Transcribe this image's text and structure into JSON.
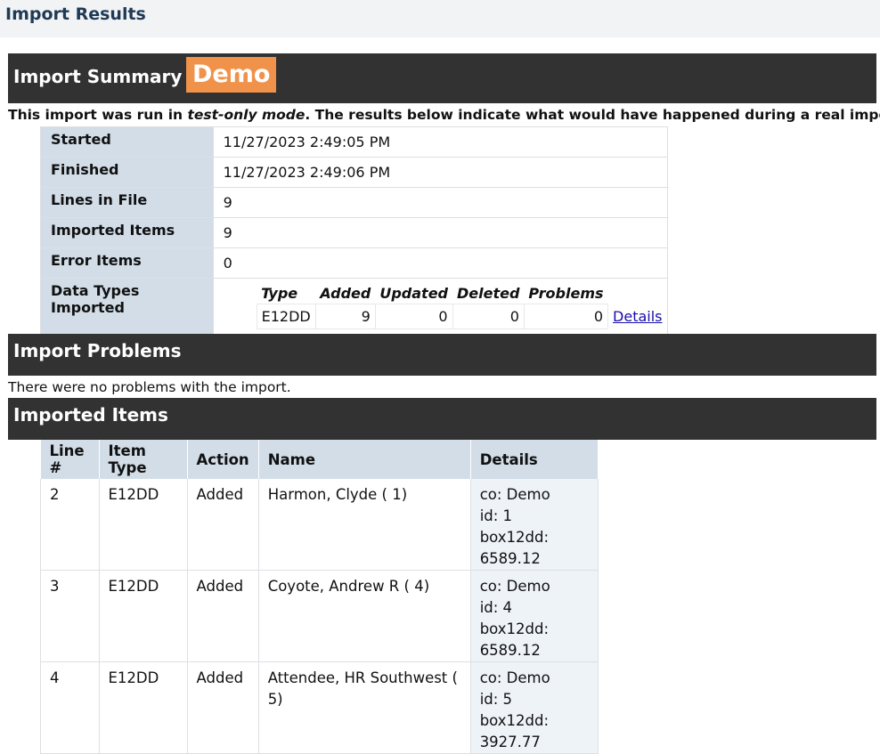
{
  "page": {
    "title": "Import Results"
  },
  "summary": {
    "heading": "Import Summary -",
    "badge": "Demo",
    "notice_pre": "This import was run in ",
    "notice_mode": "test-only mode",
    "notice_post": ". The results below indicate what would have happened during a real import.",
    "rows": [
      {
        "label": "Started",
        "value": "11/27/2023 2:49:05 PM"
      },
      {
        "label": "Finished",
        "value": "11/27/2023 2:49:06 PM"
      },
      {
        "label": "Lines in File",
        "value": "9"
      },
      {
        "label": "Imported Items",
        "value": "9"
      },
      {
        "label": "Error Items",
        "value": "0"
      }
    ],
    "types_label": "Data Types Imported",
    "types_headers": [
      "Type",
      "Added",
      "Updated",
      "Deleted",
      "Problems"
    ],
    "types_row": {
      "type": "E12DD",
      "added": "9",
      "updated": "0",
      "deleted": "0",
      "problems": "0",
      "link": "Details"
    }
  },
  "problems": {
    "heading": "Import Problems",
    "message": "There were no problems with the import."
  },
  "items": {
    "heading": "Imported Items",
    "headers": [
      "Line #",
      "Item Type",
      "Action",
      "Name",
      "Details"
    ],
    "rows": [
      {
        "line": "2",
        "type": "E12DD",
        "action": "Added",
        "name": "Harmon, Clyde ( 1)",
        "d1": "co: Demo",
        "d2": "id: 1",
        "d3": "box12dd: 6589.12"
      },
      {
        "line": "3",
        "type": "E12DD",
        "action": "Added",
        "name": "Coyote, Andrew R ( 4)",
        "d1": "co: Demo",
        "d2": "id: 4",
        "d3": "box12dd: 6589.12"
      },
      {
        "line": "4",
        "type": "E12DD",
        "action": "Added",
        "name": "Attendee, HR Southwest ( 5)",
        "d1": "co: Demo",
        "d2": "id: 5",
        "d3": "box12dd: 3927.77"
      }
    ]
  }
}
